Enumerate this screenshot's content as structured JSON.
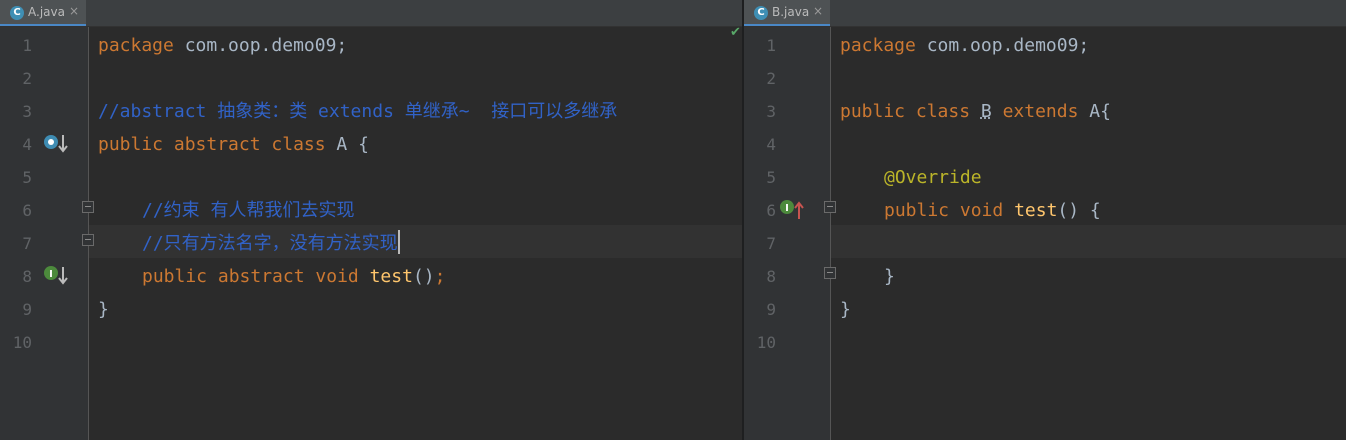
{
  "editor_a": {
    "tab": {
      "label": "A.java",
      "icon": "C",
      "close": "×"
    },
    "line_numbers": [
      "1",
      "2",
      "3",
      "4",
      "5",
      "6",
      "7",
      "8",
      "9",
      "10"
    ],
    "lines": {
      "l1_kw": "package",
      "l1_rest": " com.oop.demo09;",
      "l3": "//abstract 抽象类：类 extends 单继承~  接口可以多继承",
      "l4_kw": "public abstract class",
      "l4_rest": " A {",
      "l6": "//约束 有人帮我们去实现",
      "l7": "//只有方法名字，没有方法实现",
      "l8_kw": "public abstract void",
      "l8_fn": "test",
      "l8_rest": "()",
      "l8_semi": ";",
      "l9": "}"
    },
    "status_check": "✔"
  },
  "editor_b": {
    "tab": {
      "label": "B.java",
      "icon": "C",
      "close": "×"
    },
    "line_numbers": [
      "1",
      "2",
      "3",
      "4",
      "5",
      "6",
      "7",
      "8",
      "9",
      "10"
    ],
    "lines": {
      "l1_kw": "package",
      "l1_rest": " com.oop.demo09;",
      "l3_kw": "public class",
      "l3_b": "B",
      "l3_kw2": "extends",
      "l3_rest": " A{",
      "l5": "@Override",
      "l6_kw": "public void",
      "l6_fn": "test",
      "l6_rest": "() {",
      "l8": "}",
      "l9": "}"
    }
  },
  "colors": {
    "background": "#2b2b2b",
    "keyword": "#cc7832",
    "comment": "#3162c7",
    "function": "#ffc66d",
    "annotation": "#bbb529",
    "text": "#a9b7c6"
  }
}
